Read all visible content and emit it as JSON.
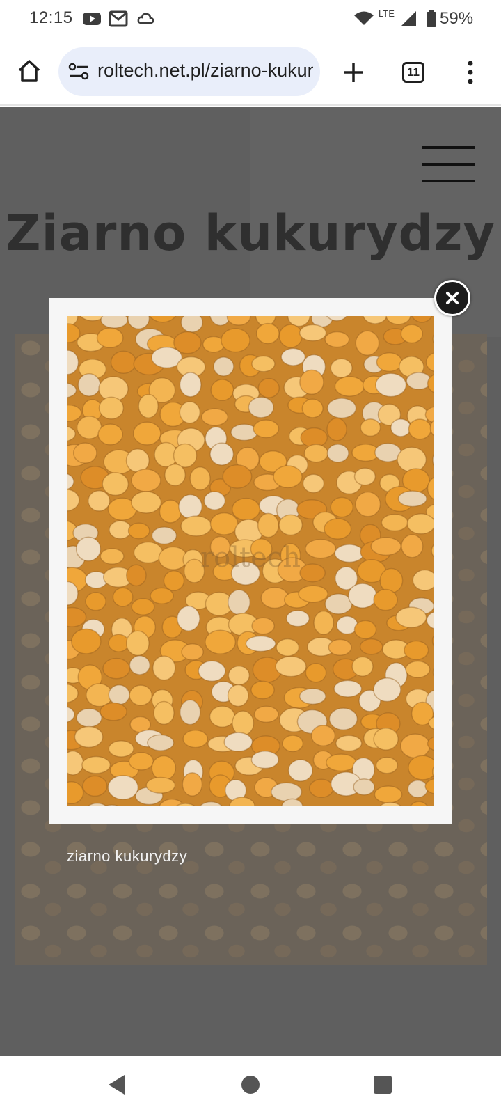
{
  "status_bar": {
    "time": "12:15",
    "network_label": "LTE",
    "battery": "59%",
    "icons": [
      "youtube-icon",
      "gmail-icon",
      "cloud-icon",
      "wifi-icon",
      "signal-icon",
      "battery-icon"
    ]
  },
  "browser": {
    "url": "roltech.net.pl/ziarno-kukurydzy",
    "tab_count": "11",
    "icons": [
      "home-icon",
      "site-info-icon",
      "new-tab-icon",
      "tabs-icon",
      "more-menu-icon"
    ]
  },
  "page": {
    "title": "Ziarno kukurydzy",
    "caption": "ziarno kukurydzy"
  },
  "lightbox": {
    "image_subject": "corn kernels",
    "watermark": "roltech"
  },
  "nav_bar": {
    "icons": [
      "back-icon",
      "home-nav-icon",
      "recents-icon"
    ]
  },
  "colors": {
    "overlay": "#5f5f5f",
    "corn_orange": "#e8a23a",
    "url_pill": "#e9eefa",
    "close_button": "#1c1c1c"
  }
}
